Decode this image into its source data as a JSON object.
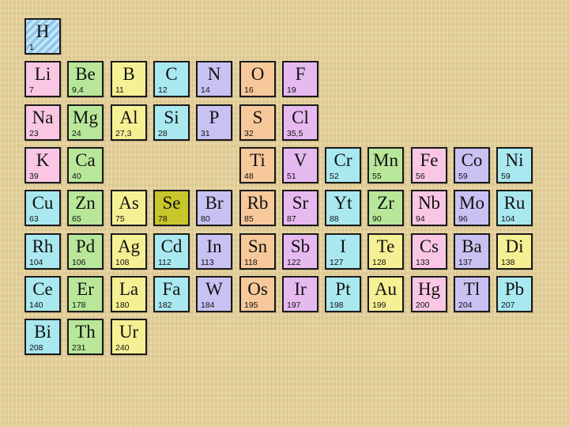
{
  "elements": [
    {
      "symbol": "H",
      "value": "1",
      "color": "h"
    },
    {
      "symbol": "Li",
      "value": "7",
      "color": "li"
    },
    {
      "symbol": "Be",
      "value": "9,4",
      "color": "be"
    },
    {
      "symbol": "B",
      "value": "11",
      "color": "b"
    },
    {
      "symbol": "C",
      "value": "12",
      "color": "c"
    },
    {
      "symbol": "N",
      "value": "14",
      "color": "n"
    },
    {
      "symbol": "O",
      "value": "16",
      "color": "o"
    },
    {
      "symbol": "F",
      "value": "19",
      "color": "f"
    },
    {
      "symbol": "Na",
      "value": "23",
      "color": "li"
    },
    {
      "symbol": "Mg",
      "value": "24",
      "color": "be"
    },
    {
      "symbol": "Al",
      "value": "27,3",
      "color": "b"
    },
    {
      "symbol": "Si",
      "value": "28",
      "color": "c"
    },
    {
      "symbol": "P",
      "value": "31",
      "color": "n"
    },
    {
      "symbol": "S",
      "value": "32",
      "color": "o"
    },
    {
      "symbol": "Cl",
      "value": "35,5",
      "color": "f"
    },
    {
      "symbol": "K",
      "value": "39",
      "color": "li"
    },
    {
      "symbol": "Ca",
      "value": "40",
      "color": "be"
    },
    {
      "symbol": "Ti",
      "value": "48",
      "color": "o"
    },
    {
      "symbol": "V",
      "value": "51",
      "color": "f"
    },
    {
      "symbol": "Cr",
      "value": "52",
      "color": "c"
    },
    {
      "symbol": "Mn",
      "value": "55",
      "color": "be"
    },
    {
      "symbol": "Fe",
      "value": "56",
      "color": "li"
    },
    {
      "symbol": "Co",
      "value": "59",
      "color": "n"
    },
    {
      "symbol": "Ni",
      "value": "59",
      "color": "c"
    },
    {
      "symbol": "Cu",
      "value": "63",
      "color": "c"
    },
    {
      "symbol": "Zn",
      "value": "65",
      "color": "be"
    },
    {
      "symbol": "As",
      "value": "75",
      "color": "b"
    },
    {
      "symbol": "Se",
      "value": "78",
      "color": "se"
    },
    {
      "symbol": "Br",
      "value": "80",
      "color": "n"
    },
    {
      "symbol": "Rb",
      "value": "85",
      "color": "o"
    },
    {
      "symbol": "Sr",
      "value": "87",
      "color": "f"
    },
    {
      "symbol": "Yt",
      "value": "88",
      "color": "c"
    },
    {
      "symbol": "Zr",
      "value": "90",
      "color": "be"
    },
    {
      "symbol": "Nb",
      "value": "94",
      "color": "li"
    },
    {
      "symbol": "Mo",
      "value": "96",
      "color": "n"
    },
    {
      "symbol": "Ru",
      "value": "104",
      "color": "c"
    },
    {
      "symbol": "Rh",
      "value": "104",
      "color": "c"
    },
    {
      "symbol": "Pd",
      "value": "106",
      "color": "be"
    },
    {
      "symbol": "Ag",
      "value": "108",
      "color": "b"
    },
    {
      "symbol": "Cd",
      "value": "112",
      "color": "c"
    },
    {
      "symbol": "In",
      "value": "113",
      "color": "n"
    },
    {
      "symbol": "Sn",
      "value": "118",
      "color": "o"
    },
    {
      "symbol": "Sb",
      "value": "122",
      "color": "f"
    },
    {
      "symbol": "I",
      "value": "127",
      "color": "c"
    },
    {
      "symbol": "Te",
      "value": "128",
      "color": "b"
    },
    {
      "symbol": "Cs",
      "value": "133",
      "color": "li"
    },
    {
      "symbol": "Ba",
      "value": "137",
      "color": "n"
    },
    {
      "symbol": "Di",
      "value": "138",
      "color": "b"
    },
    {
      "symbol": "Ce",
      "value": "140",
      "color": "c"
    },
    {
      "symbol": "Er",
      "value": "178",
      "color": "be"
    },
    {
      "symbol": "La",
      "value": "180",
      "color": "b"
    },
    {
      "symbol": "Fa",
      "value": "182",
      "color": "c"
    },
    {
      "symbol": "W",
      "value": "184",
      "color": "n"
    },
    {
      "symbol": "Os",
      "value": "195",
      "color": "o"
    },
    {
      "symbol": "Ir",
      "value": "197",
      "color": "f"
    },
    {
      "symbol": "Pt",
      "value": "198",
      "color": "c"
    },
    {
      "symbol": "Au",
      "value": "199",
      "color": "b"
    },
    {
      "symbol": "Hg",
      "value": "200",
      "color": "li"
    },
    {
      "symbol": "Tl",
      "value": "204",
      "color": "n"
    },
    {
      "symbol": "Pb",
      "value": "207",
      "color": "c"
    },
    {
      "symbol": "Bi",
      "value": "208",
      "color": "c"
    },
    {
      "symbol": "Th",
      "value": "231",
      "color": "be"
    },
    {
      "symbol": "Ur",
      "value": "240",
      "color": "b"
    }
  ]
}
